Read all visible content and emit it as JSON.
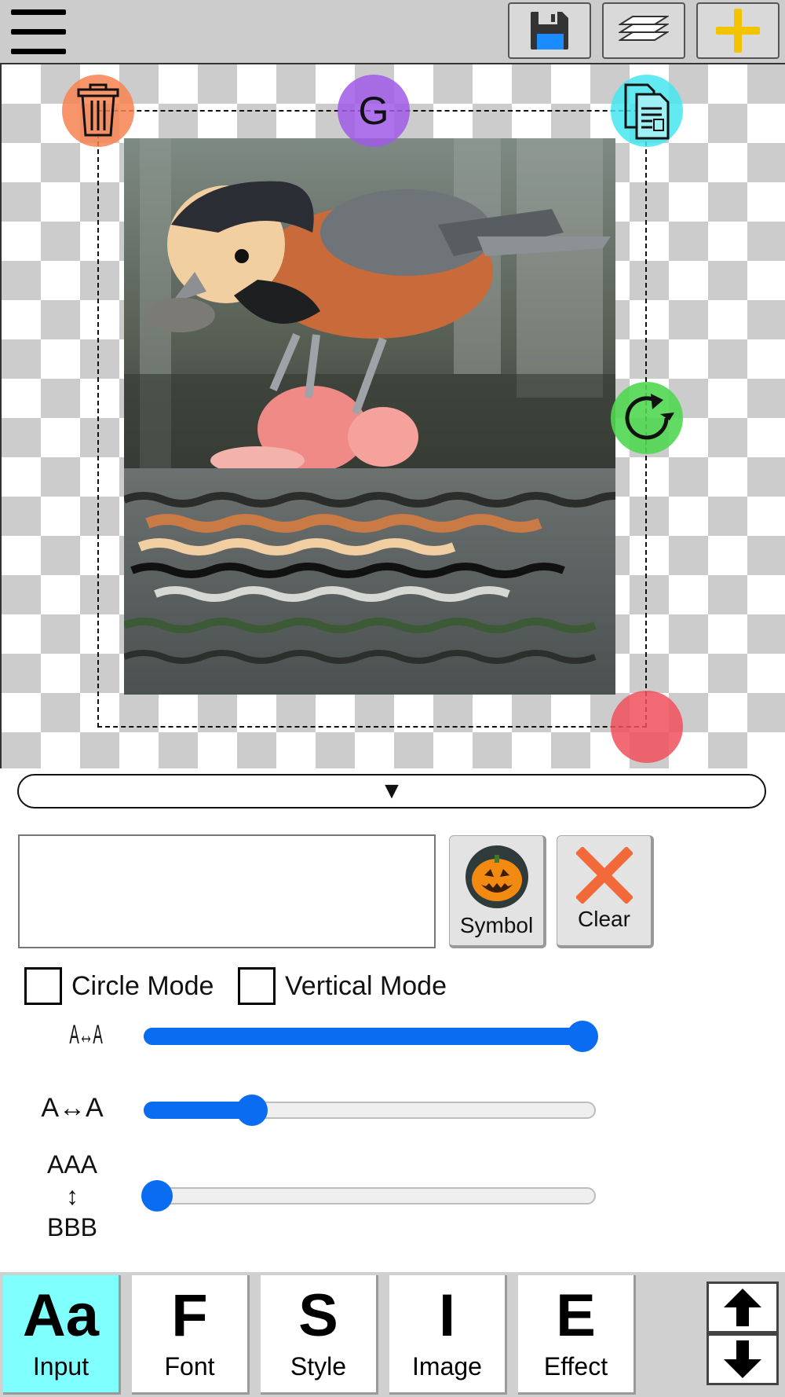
{
  "toolbar": {
    "menu_icon": "hamburger-menu-icon",
    "save_icon": "floppy-disk-icon",
    "layers_icon": "layers-icon",
    "add_icon": "plus-icon",
    "accent_add": "#f2c300",
    "accent_save": "#1a8cff"
  },
  "canvas": {
    "handles": {
      "delete_icon": "trash-can-icon",
      "group_label": "G",
      "duplicate_icon": "copy-documents-icon",
      "rotate_icon": "rotate-icon",
      "resize_icon": "resize-handle"
    }
  },
  "panel": {
    "collapse_glyph": "▼",
    "text_input": {
      "value": "",
      "placeholder": ""
    },
    "symbol_button": {
      "label": "Symbol",
      "icon": "jack-o-lantern-icon"
    },
    "clear_button": {
      "label": "Clear",
      "icon": "x-icon"
    },
    "circle_mode": {
      "label": "Circle Mode",
      "checked": false
    },
    "vertical_mode": {
      "label": "Vertical Mode",
      "checked": false
    },
    "sliders": [
      {
        "label": "A↔A",
        "value": 0.97
      },
      {
        "label": "A↔A",
        "value": 0.24
      },
      {
        "label_top": "AAA",
        "label_mid": "↕",
        "label_bottom": "BBB",
        "value": 0.03
      }
    ]
  },
  "tabs": [
    {
      "big": "Aa",
      "small": "Input",
      "active": true
    },
    {
      "big": "F",
      "small": "Font",
      "active": false
    },
    {
      "big": "S",
      "small": "Style",
      "active": false
    },
    {
      "big": "I",
      "small": "Image",
      "active": false
    },
    {
      "big": "E",
      "effect": true,
      "small": "Effect",
      "active": false
    }
  ],
  "scroll": {
    "up_icon": "arrow-up-icon",
    "down_icon": "arrow-down-icon"
  }
}
